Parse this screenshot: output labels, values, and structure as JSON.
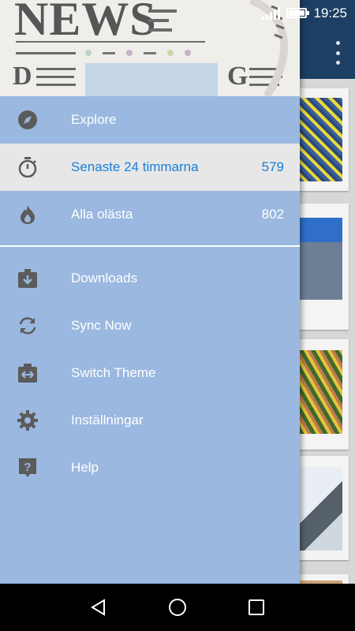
{
  "status_bar": {
    "time": "19:25"
  },
  "drawer_header": {
    "logo_letters": [
      "NEWS",
      "D",
      "G"
    ]
  },
  "menu": {
    "items": [
      {
        "label": "Explore",
        "icon": "compass-icon"
      },
      {
        "label": "Senaste 24 timmarna",
        "icon": "stopwatch-icon",
        "count": "579",
        "active": true
      },
      {
        "label": "Alla olästa",
        "icon": "flame-icon",
        "count": "802"
      },
      {
        "label": "Downloads",
        "icon": "download-box-icon"
      },
      {
        "label": "Sync Now",
        "icon": "sync-icon"
      },
      {
        "label": "Switch Theme",
        "icon": "switch-theme-icon"
      },
      {
        "label": "Inställningar",
        "icon": "gear-icon"
      },
      {
        "label": "Help",
        "icon": "help-icon"
      }
    ]
  },
  "colors": {
    "drawer_bg": "#9ab8e0",
    "active_text": "#1a7fd6",
    "active_bg": "#e7e7e7",
    "icon": "#5b5b5b",
    "toolbar": "#1c3f63"
  }
}
